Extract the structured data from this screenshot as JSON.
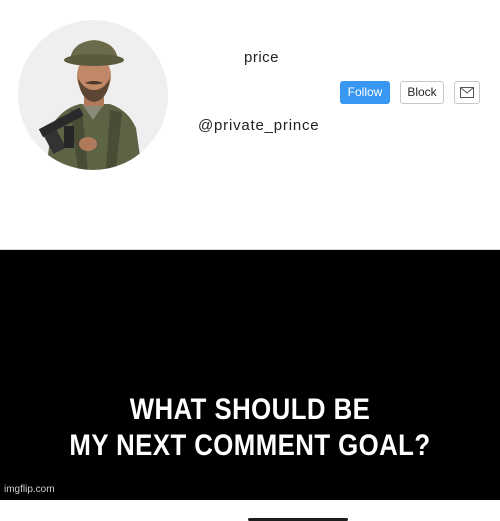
{
  "profile": {
    "username": "price",
    "handle": "@private_prince",
    "follow_label": "Follow",
    "block_label": "Block",
    "message_icon": "envelope-icon",
    "avatar_icon": "soldier-avatar"
  },
  "caption": {
    "line1": "WHAT SHOULD BE",
    "line2": "MY NEXT COMMENT GOAL?"
  },
  "watermark": "imgflip.com",
  "colors": {
    "follow_button": "#3897f0",
    "top_background": "#ffffff",
    "bottom_background": "#000000",
    "caption_text": "#ffffff"
  }
}
